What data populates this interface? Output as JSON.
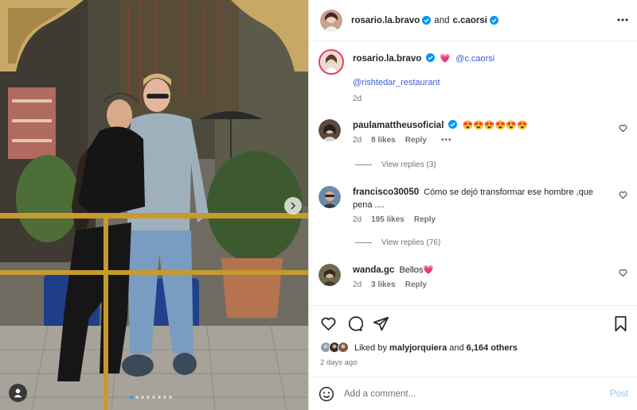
{
  "header": {
    "user1": "rosario.la.bravo",
    "and_text": "and",
    "user2": "c.caorsi"
  },
  "caption": {
    "username": "rosario.la.bravo",
    "emoji": "💗",
    "mention1": "@c.caorsi",
    "mention2": "@rishtedar_restaurant",
    "time": "2d"
  },
  "comments": [
    {
      "username": "paulamattheusoficial",
      "text": "😍😍😍😍😍😍",
      "time": "2d",
      "likes": "8 likes",
      "reply": "Reply",
      "options": "•••",
      "replies": "View replies (3)"
    },
    {
      "username": "francisco30050",
      "text": "Cómo se dejó transformar ese hombre ,que pena ....",
      "time": "2d",
      "likes": "195 likes",
      "reply": "Reply",
      "replies": "View replies (76)"
    },
    {
      "username": "wanda.gc",
      "text": "Bellos💗",
      "time": "2d",
      "likes": "3 likes",
      "reply": "Reply"
    }
  ],
  "likes": {
    "prefix": "Liked by",
    "user": "malyjorquiera",
    "and_text": "and",
    "others": "6,164 others"
  },
  "time_ago": "2 days ago",
  "add_comment": {
    "placeholder": "Add a comment...",
    "post_label": "Post"
  },
  "carousel": {
    "slides": 8,
    "current": 1
  },
  "colors": {
    "verified": "#0095f6",
    "link": "#3b5ddc",
    "post_disabled": "#8fc6f5"
  }
}
